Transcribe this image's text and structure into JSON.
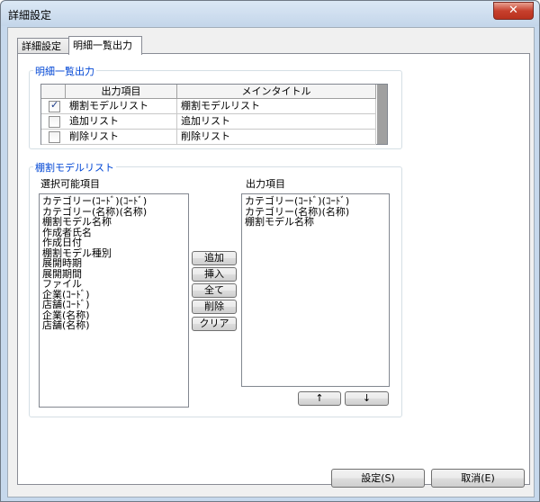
{
  "window": {
    "title": "詳細設定",
    "close_symbol": "✕"
  },
  "tabs": [
    {
      "label": "詳細設定",
      "active": false
    },
    {
      "label": "明細一覧出力",
      "active": true
    }
  ],
  "detail_output": {
    "group_label": "明細一覧出力",
    "columns": {
      "output_item": "出力項目",
      "main_title": "メインタイトル"
    },
    "rows": [
      {
        "checked": true,
        "item": "棚割モデルリスト",
        "title": "棚割モデルリスト"
      },
      {
        "checked": false,
        "item": "追加リスト",
        "title": "追加リスト"
      },
      {
        "checked": false,
        "item": "削除リスト",
        "title": "削除リスト"
      }
    ]
  },
  "model_list": {
    "group_label": "棚割モデルリスト",
    "available_label": "選択可能項目",
    "output_label": "出力項目",
    "available_items": [
      "カテゴリー(ｺｰﾄﾞ)(ｺｰﾄﾞ)",
      "カテゴリー(名称)(名称)",
      "棚割モデル名称",
      "作成者氏名",
      "作成日付",
      "棚割モデル種別",
      "展開時期",
      "展開期間",
      "ファイル",
      "企業(ｺｰﾄﾞ)",
      "店舗(ｺｰﾄﾞ)",
      "企業(名称)",
      "店舗(名称)"
    ],
    "output_items": [
      "カテゴリー(ｺｰﾄﾞ)(ｺｰﾄﾞ)",
      "カテゴリー(名称)(名称)",
      "棚割モデル名称"
    ],
    "buttons": {
      "add": "追加",
      "insert": "挿入",
      "all": "全て",
      "delete": "削除",
      "clear": "クリア"
    },
    "move_up": "↑",
    "move_down": "↓"
  },
  "footer": {
    "ok": "設定(S)",
    "cancel": "取消(E)"
  }
}
